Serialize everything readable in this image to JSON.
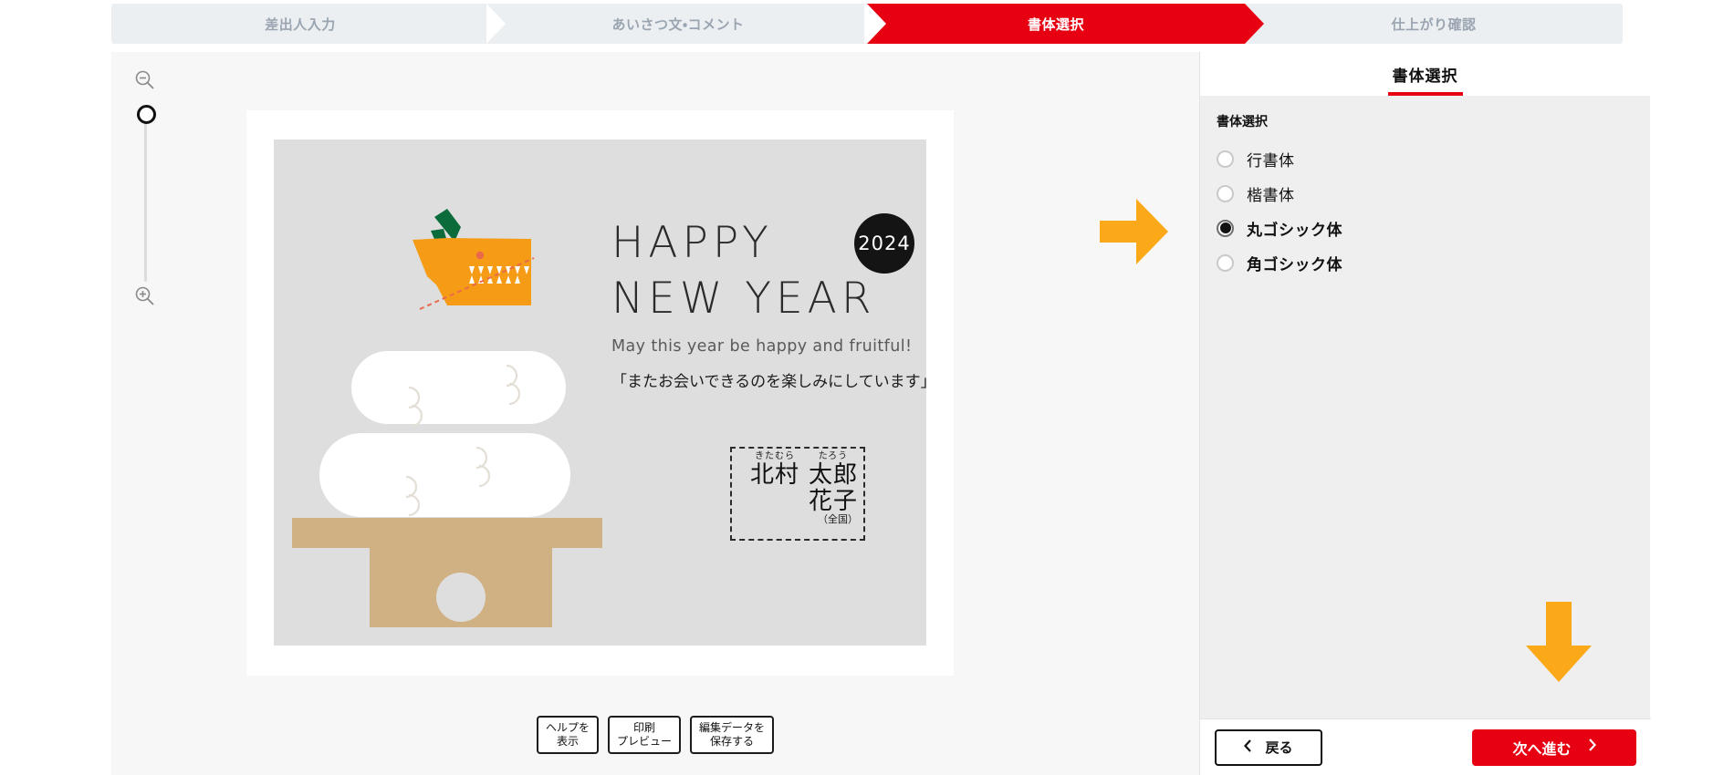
{
  "stepper": {
    "steps": [
      {
        "label": "差出人入力",
        "active": false
      },
      {
        "label": "あいさつ文・コメント",
        "active": false
      },
      {
        "label": "書体選択",
        "active": true
      },
      {
        "label": "仕上がり確認",
        "active": false
      }
    ]
  },
  "editor": {
    "zoom": {
      "zoom_out_icon": "magnifier-minus-icon",
      "zoom_in_icon": "magnifier-plus-icon"
    },
    "card": {
      "heading_line1": "HAPPY",
      "heading_line2": "NEW YEAR",
      "year_badge": "2024",
      "subline": "May this year be happy and fruitful!",
      "jp_comment": "「またお会いできるのを楽しみにしています」",
      "name": {
        "furigana_family": "きたむら",
        "family": "北村",
        "furigana_given": "たろう",
        "given": "太郎",
        "given2": "花子",
        "region": "（全国）"
      }
    },
    "tools": [
      {
        "line1": "ヘルプを",
        "line2": "表示"
      },
      {
        "line1": "印刷",
        "line2": "プレビュー"
      },
      {
        "line1": "編集データを",
        "line2": "保存する"
      }
    ]
  },
  "panel": {
    "header_title": "書体選択",
    "group_label": "書体選択",
    "options": [
      {
        "label": "行書体",
        "checked": false
      },
      {
        "label": "楷書体",
        "checked": false
      },
      {
        "label": "丸ゴシック体",
        "checked": true
      },
      {
        "label": "角ゴシック体",
        "checked": false
      }
    ],
    "footer": {
      "back_label": "戻る",
      "back_icon": "chevron-left-icon",
      "next_label": "次へ進む",
      "next_icon": "chevron-right-icon"
    }
  },
  "annotations": {
    "arrow_right": "arrow-right-icon",
    "arrow_down": "arrow-down-icon"
  },
  "colors": {
    "accent_red": "#e60012",
    "annotation_orange": "#FBA919",
    "panel_bg": "#efefef",
    "card_bg": "#dedede",
    "mochi_stand": "#d0b183",
    "dragon_orange": "#F59B16",
    "leaf_green": "#0B6B3A"
  }
}
